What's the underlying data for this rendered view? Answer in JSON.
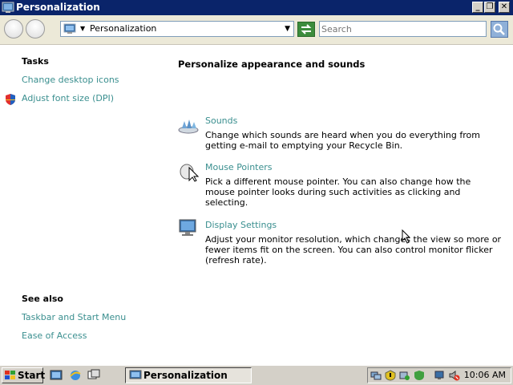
{
  "window": {
    "title": "Personalization",
    "minimize": "_",
    "restore": "❐",
    "close": "✕"
  },
  "nav": {
    "address_text": "Personalization",
    "search_placeholder": "Search"
  },
  "sidebar": {
    "tasks_heading": "Tasks",
    "tasks": [
      {
        "label": "Change desktop icons"
      },
      {
        "label": "Adjust font size (DPI)"
      }
    ],
    "see_also_heading": "See also",
    "see_also": [
      {
        "label": "Taskbar and Start Menu"
      },
      {
        "label": "Ease of Access"
      }
    ]
  },
  "main": {
    "heading": "Personalize appearance and sounds",
    "items": [
      {
        "title": "Sounds",
        "description": "Change which sounds are heard when you do everything from getting e-mail to emptying your Recycle Bin.",
        "icon": "sounds-icon"
      },
      {
        "title": "Mouse Pointers",
        "description": "Pick a different mouse pointer. You can also change how the mouse pointer looks during such activities as clicking and selecting.",
        "icon": "mouse-pointers-icon"
      },
      {
        "title": "Display Settings",
        "description": "Adjust your monitor resolution, which changes the view so more or fewer items fit on the screen. You can also control monitor flicker (refresh rate).",
        "icon": "display-icon"
      }
    ]
  },
  "taskbar": {
    "start_label": "Start",
    "active_task": "Personalization",
    "clock": "10:06 AM"
  },
  "colors": {
    "title_bar": "#0a246a",
    "link": "#3a8f8f",
    "taskbar": "#d4d0c8"
  }
}
